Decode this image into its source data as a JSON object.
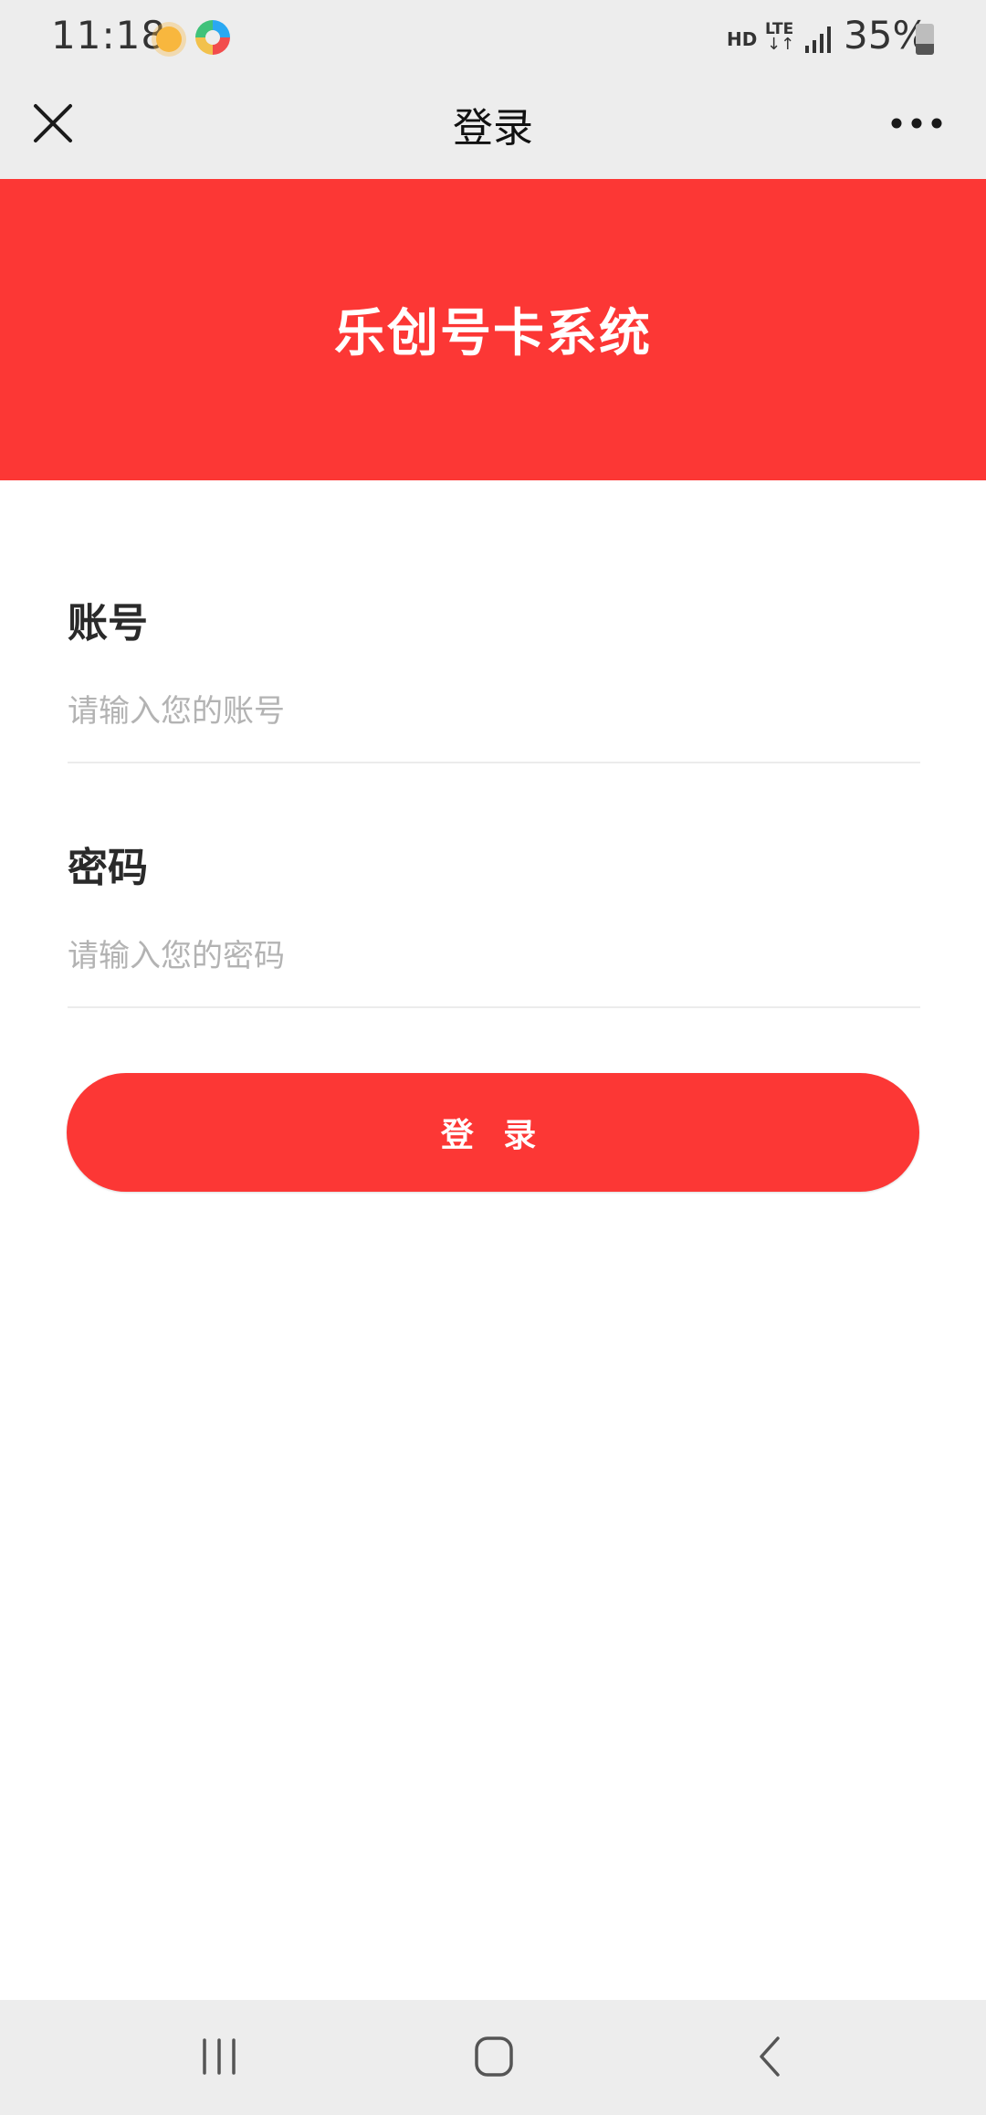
{
  "status_bar": {
    "time": "11:18",
    "network_hd": "HD",
    "network_lte": "LTE",
    "network_arrows": "↓↑",
    "battery_percent": "35%",
    "battery_level": 0.35,
    "weather_icon": "sun-icon",
    "notification_icon": "app-notification-icon"
  },
  "nav": {
    "title": "登录",
    "close_icon": "close-icon",
    "more_icon": "more-icon"
  },
  "banner": {
    "title": "乐创号卡系统",
    "color": "#fc3735"
  },
  "form": {
    "account": {
      "label": "账号",
      "placeholder": "请输入您的账号",
      "value": ""
    },
    "password": {
      "label": "密码",
      "placeholder": "请输入您的密码",
      "value": ""
    },
    "submit_label": "登 录"
  },
  "system_nav": {
    "recents_icon": "recents-icon",
    "home_icon": "home-icon",
    "back_icon": "back-icon"
  },
  "colors": {
    "accent": "#fc3735",
    "chrome": "#ededed"
  }
}
